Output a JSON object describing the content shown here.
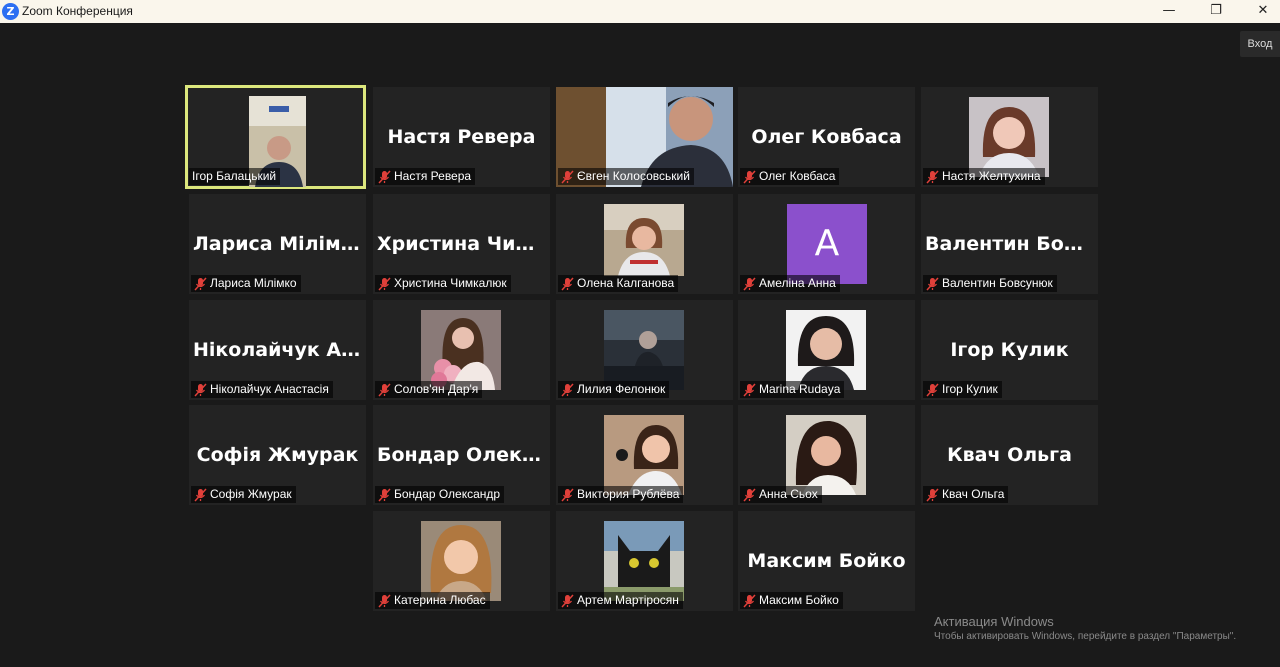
{
  "window": {
    "title": "Zoom Конференция",
    "app_icon": "zoom-icon",
    "buttons": {
      "minimize": "—",
      "restore": "❐",
      "close": "✕"
    }
  },
  "toolbar": {
    "enter_label": "Вход"
  },
  "participants": [
    {
      "name": "Ігор Балацький",
      "big_name": "",
      "muted": false,
      "speaking": true,
      "video": "photo"
    },
    {
      "name": "Настя Ревера",
      "big_name": "Настя Ревера",
      "muted": true
    },
    {
      "name": "Євген Колосовський",
      "big_name": "",
      "muted": true,
      "video": "photo"
    },
    {
      "name": "Олег Ковбаса",
      "big_name": "Олег Ковбаса",
      "muted": true
    },
    {
      "name": "Настя Желтухина",
      "big_name": "",
      "muted": true,
      "video": "photo"
    },
    {
      "name": "Лариса Мілімко",
      "big_name": "Лариса Мілімко",
      "muted": true
    },
    {
      "name": "Христина Чимкалюк",
      "big_name": "Христина  Чим...",
      "muted": true
    },
    {
      "name": "Олена Калганова",
      "big_name": "",
      "muted": true,
      "video": "photo"
    },
    {
      "name": "Амеліна Анна",
      "big_name": "",
      "muted": true,
      "avatar_letter": "A"
    },
    {
      "name": "Валентин Бовсунюк",
      "big_name": "Валентин  Бовс...",
      "muted": true
    },
    {
      "name": "Ніколайчук Анастасія",
      "big_name": "Ніколайчук  Ан...",
      "muted": true
    },
    {
      "name": "Солов'ян Дар'я",
      "big_name": "",
      "muted": true,
      "video": "photo"
    },
    {
      "name": "Лилия Фелонюк",
      "big_name": "",
      "muted": true,
      "video": "photo"
    },
    {
      "name": "Marina Rudaya",
      "big_name": "",
      "muted": true,
      "video": "photo"
    },
    {
      "name": "Ігор Кулик",
      "big_name": "Ігор Кулик",
      "muted": true
    },
    {
      "name": "Софія Жмурак",
      "big_name": "Софія Жмурак",
      "muted": true
    },
    {
      "name": "Бондар Олександр",
      "big_name": "Бондар  Олекса...",
      "muted": true
    },
    {
      "name": "Виктория Рублёва",
      "big_name": "",
      "muted": true,
      "video": "photo"
    },
    {
      "name": "Анна Сьох",
      "big_name": "",
      "muted": true,
      "video": "photo"
    },
    {
      "name": "Квач Ольга",
      "big_name": "Квач Ольга",
      "muted": true
    },
    {
      "name": "Катерина Любас",
      "big_name": "",
      "muted": true,
      "video": "photo"
    },
    {
      "name": "Артем Мартіросян",
      "big_name": "",
      "muted": true,
      "video": "photo"
    },
    {
      "name": "Максим Бойко",
      "big_name": "Максим Бойко",
      "muted": true
    }
  ],
  "watermark": {
    "title": "Активация Windows",
    "subtitle": "Чтобы активировать Windows, перейдите в раздел \"Параметры\"."
  },
  "colors": {
    "active_speaker_border": "#dce77d",
    "muted_icon": "#e0403a",
    "avatar_bg": "#8b50cc"
  }
}
